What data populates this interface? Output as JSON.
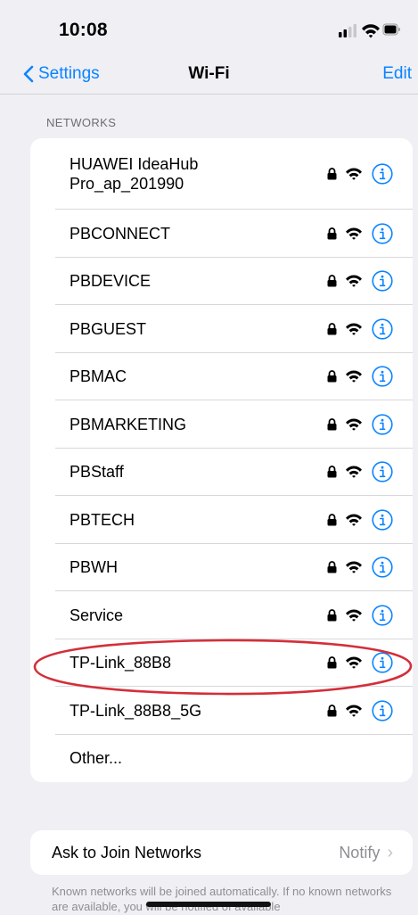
{
  "status_bar": {
    "time": "10:08",
    "signal_icon": "cellular-signal-icon",
    "wifi_icon": "wifi-icon",
    "battery_icon": "battery-icon"
  },
  "nav": {
    "back_label": "Settings",
    "title": "Wi-Fi",
    "edit_label": "Edit"
  },
  "networks_header": "NETWORKS",
  "networks": [
    {
      "line1": "HUAWEI IdeaHub",
      "line2": "Pro_ap_201990",
      "locked": true
    },
    {
      "line1": "PBCONNECT",
      "line2": "",
      "locked": true
    },
    {
      "line1": "PBDEVICE",
      "line2": "",
      "locked": true
    },
    {
      "line1": "PBGUEST",
      "line2": "",
      "locked": true
    },
    {
      "line1": "PBMAC",
      "line2": "",
      "locked": true
    },
    {
      "line1": "PBMARKETING",
      "line2": "",
      "locked": true
    },
    {
      "line1": "PBStaff",
      "line2": "",
      "locked": true
    },
    {
      "line1": "PBTECH",
      "line2": "",
      "locked": true
    },
    {
      "line1": "PBWH",
      "line2": "",
      "locked": true
    },
    {
      "line1": "Service",
      "line2": "",
      "locked": true
    },
    {
      "line1": "TP-Link_88B8",
      "line2": "",
      "locked": true,
      "highlighted": true
    },
    {
      "line1": "TP-Link_88B8_5G",
      "line2": "",
      "locked": true
    },
    {
      "line1": "Other...",
      "line2": "",
      "locked": false
    }
  ],
  "ask_to_join": {
    "label": "Ask to Join Networks",
    "value": "Notify",
    "chevron": "›"
  },
  "footer_note": "Known networks will be joined automatically. If no known networks are available, you will be notified of available",
  "colors": {
    "accent": "#0a84ff",
    "highlight": "#d32f3a",
    "background": "#efeff4"
  }
}
